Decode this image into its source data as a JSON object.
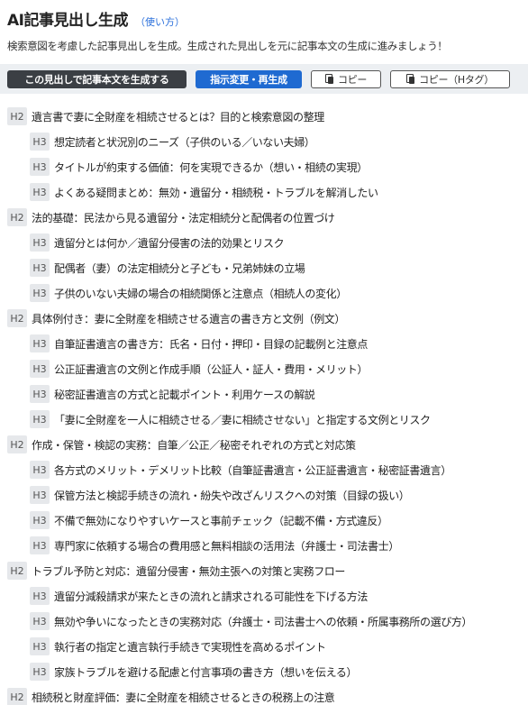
{
  "header": {
    "title": "AI記事見出し生成",
    "help_link": "（使い方）"
  },
  "description": "検索意図を考慮した記事見出しを生成。生成された見出しを元に記事本文の生成に進みましょう！",
  "toolbar": {
    "generate_body_label": "この見出しで記事本文を生成する",
    "regenerate_label": "指示変更・再生成",
    "copy_label": "コピー",
    "copy_htag_label": "コピー（Hタグ）"
  },
  "outline": [
    {
      "level": "H2",
      "text": "遺言書で妻に全財産を相続させるとは？目的と検索意図の整理"
    },
    {
      "level": "H3",
      "text": "想定読者と状況別のニーズ（子供のいる／いない夫婦）"
    },
    {
      "level": "H3",
      "text": "タイトルが約束する価値：何を実現できるか（想い・相続の実現）"
    },
    {
      "level": "H3",
      "text": "よくある疑問まとめ：無効・遺留分・相続税・トラブルを解消したい"
    },
    {
      "level": "H2",
      "text": "法的基礎：民法から見る遺留分・法定相続分と配偶者の位置づけ"
    },
    {
      "level": "H3",
      "text": "遺留分とは何か／遺留分侵害の法的効果とリスク"
    },
    {
      "level": "H3",
      "text": "配偶者（妻）の法定相続分と子ども・兄弟姉妹の立場"
    },
    {
      "level": "H3",
      "text": "子供のいない夫婦の場合の相続関係と注意点（相続人の変化）"
    },
    {
      "level": "H2",
      "text": "具体例付き：妻に全財産を相続させる遺言の書き方と文例（例文）"
    },
    {
      "level": "H3",
      "text": "自筆証書遺言の書き方：氏名・日付・押印・目録の記載例と注意点"
    },
    {
      "level": "H3",
      "text": "公正証書遺言の文例と作成手順（公証人・証人・費用・メリット）"
    },
    {
      "level": "H3",
      "text": "秘密証書遺言の方式と記載ポイント・利用ケースの解説"
    },
    {
      "level": "H3",
      "text": "「妻に全財産を一人に相続させる／妻に相続させない」と指定する文例とリスク"
    },
    {
      "level": "H2",
      "text": "作成・保管・検認の実務：自筆／公正／秘密それぞれの方式と対応策"
    },
    {
      "level": "H3",
      "text": "各方式のメリット・デメリット比較（自筆証書遺言・公正証書遺言・秘密証書遺言）"
    },
    {
      "level": "H3",
      "text": "保管方法と検認手続きの流れ・紛失や改ざんリスクへの対策（目録の扱い）"
    },
    {
      "level": "H3",
      "text": "不備で無効になりやすいケースと事前チェック（記載不備・方式違反）"
    },
    {
      "level": "H3",
      "text": "専門家に依頼する場合の費用感と無料相談の活用法（弁護士・司法書士）"
    },
    {
      "level": "H2",
      "text": "トラブル予防と対応：遺留分侵害・無効主張への対策と実務フロー"
    },
    {
      "level": "H3",
      "text": "遺留分減殺請求が来たときの流れと請求される可能性を下げる方法"
    },
    {
      "level": "H3",
      "text": "無効や争いになったときの実務対応（弁護士・司法書士への依頼・所属事務所の選び方）"
    },
    {
      "level": "H3",
      "text": "執行者の指定と遺言執行手続きで実現性を高めるポイント"
    },
    {
      "level": "H3",
      "text": "家族トラブルを避ける配慮と付言事項の書き方（想いを伝える）"
    },
    {
      "level": "H2",
      "text": "相続税と財産評価：妻に全財産を相続させるときの税務上の注意"
    }
  ]
}
